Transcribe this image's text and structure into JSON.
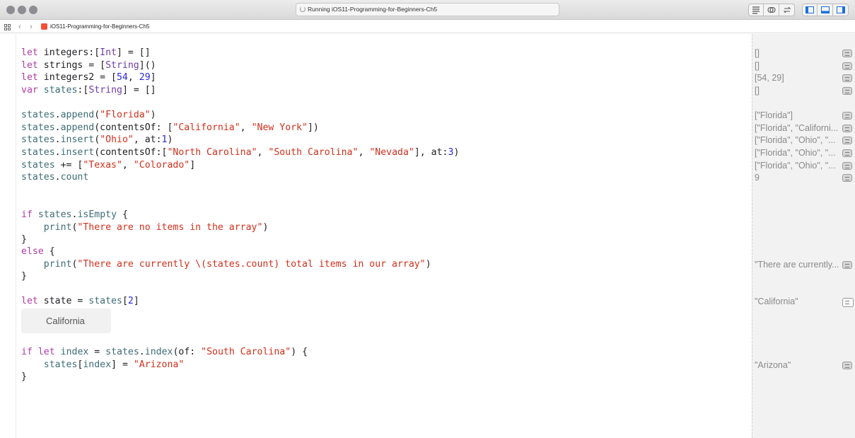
{
  "window": {
    "activity_text": "Running iOS11-Programming-for-Beginners-Ch5"
  },
  "jumpbar": {
    "file_name": "iOS11-Programming-for-Beginners-Ch5"
  },
  "code": {
    "lines": [
      "let integers:[Int] = []",
      "let strings = [String]()",
      "let integers2 = [54, 29]",
      "var states:[String] = []",
      "states.append(\"Florida\")",
      "states.append(contentsOf: [\"California\", \"New York\"])",
      "states.insert(\"Ohio\", at:1)",
      "states.insert(contentsOf:[\"North Carolina\", \"South Carolina\", \"Nevada\"], at:3)",
      "states += [\"Texas\", \"Colorado\"]",
      "states.count",
      "if states.isEmpty {",
      "    print(\"There are no items in the array\")",
      "}",
      "else {",
      "    print(\"There are currently \\(states.count) total items in our array\")",
      "}",
      "let state = states[2]",
      "if let index = states.index(of: \"South Carolina\") {",
      "    states[index] = \"Arizona\"",
      "}"
    ]
  },
  "inline_result": "California",
  "results": [
    "[]",
    "[]",
    "[54, 29]",
    "[]",
    "[\"Florida\"]",
    "[\"Florida\", \"Californi...",
    "[\"Florida\", \"Ohio\", \"...",
    "[\"Florida\", \"Ohio\", \"...",
    "[\"Florida\", \"Ohio\", \"...",
    "9",
    "\"There are currently...",
    "\"California\"",
    "\"Arizona\""
  ],
  "icons": {
    "toolbar": [
      "editor-standard-icon",
      "editor-assistant-icon",
      "editor-version-icon",
      "navigator-panel-icon",
      "debug-panel-icon",
      "utilities-panel-icon"
    ],
    "quick_look": "quick-look-eye-icon"
  },
  "colors": {
    "keyword": "#ad3da4",
    "type": "#703daa",
    "string": "#d12f1b",
    "number": "#272ad8",
    "identifier": "#3e6d74",
    "result_text": "#8a8a8a"
  }
}
